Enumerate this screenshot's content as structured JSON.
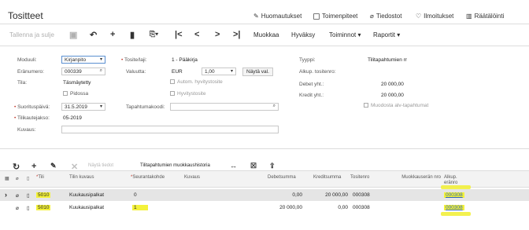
{
  "header": {
    "title": "Tositteet",
    "links": [
      {
        "label": "Huomautukset",
        "icon": "note-icon"
      },
      {
        "label": "Toimenpiteet",
        "icon": "calendar-icon"
      },
      {
        "label": "Tiedostot",
        "icon": "paperclip-icon"
      },
      {
        "label": "Ilmoitukset",
        "icon": "bell-icon"
      },
      {
        "label": "Räätälöinti",
        "icon": "chart-icon"
      }
    ]
  },
  "toolbar": {
    "save_close": "Tallenna ja sulje",
    "edit": "Muokkaa",
    "approve": "Hyväksy",
    "actions": "Toiminnot ▾",
    "reports": "Raportit ▾"
  },
  "form": {
    "module_label": "Moduuli:",
    "module_value": "Kirjanpito",
    "batch_label": "Eränumero:",
    "batch_value": "000339",
    "status_label": "Tila:",
    "status_value": "Täsmäytetty",
    "onhold_label": "Pidossa",
    "postdate_label": "Suorituspäivä:",
    "postdate_value": "31.5.2019",
    "period_label": "Tilikautejakso:",
    "period_value": "05-2019",
    "desc_label": "Kuvaus:",
    "desc_value": "",
    "ledger_label": "Tosite/laji:",
    "ledger_value": "1 - Pääkirja",
    "currency_label": "Valuutta:",
    "currency_value": "EUR",
    "rate_value": "1,00",
    "view_rate": "Näytä val.",
    "auto_reverse": "Autom. hyvitystosite",
    "reversing": "Hyvitystosite",
    "trancode_label": "Tapahtumakoodi:",
    "trancode_value": "",
    "type_label": "Tyyppi:",
    "type_value": "Tilitapahtumien rr",
    "orig_batch_label": "Alkup. tositenro:",
    "orig_batch_value": "",
    "debit_label": "Debet yht.:",
    "debit_value": "20 000,00",
    "credit_label": "Kredit yht.:",
    "credit_value": "20 000,00",
    "vat_label": "Muodosta alv-tapahtumat"
  },
  "grid_toolbar": {
    "show_details": "Näytä tiedot",
    "history": "Tilitapahtumien muokkaushistoria"
  },
  "grid": {
    "headers": {
      "account": "Tili",
      "account_desc": "Tilin kuvaus",
      "subaccount": "Seurantakohde",
      "description": "Kuvaus",
      "debit": "Debetsumma",
      "credit": "Kreditsumma",
      "batch": "Tositenro",
      "cat": "Muokkauserän nro",
      "orig": "Alkup. eränro"
    },
    "rows": [
      {
        "account": "5010",
        "account_desc": "Kuukausipalkat",
        "subaccount": "0",
        "description": "",
        "debit": "0,00",
        "credit": "20 000,00",
        "batch": "000308",
        "orig": "000308"
      },
      {
        "account": "5010",
        "account_desc": "Kuukausipalkat",
        "subaccount": "1",
        "description": "",
        "debit": "20 000,00",
        "credit": "0,00",
        "batch": "000308",
        "orig": "000308"
      }
    ]
  },
  "colors": {
    "highlight": "#f4f23a",
    "link": "#2b63b8",
    "accent": "#5a8fd0"
  }
}
